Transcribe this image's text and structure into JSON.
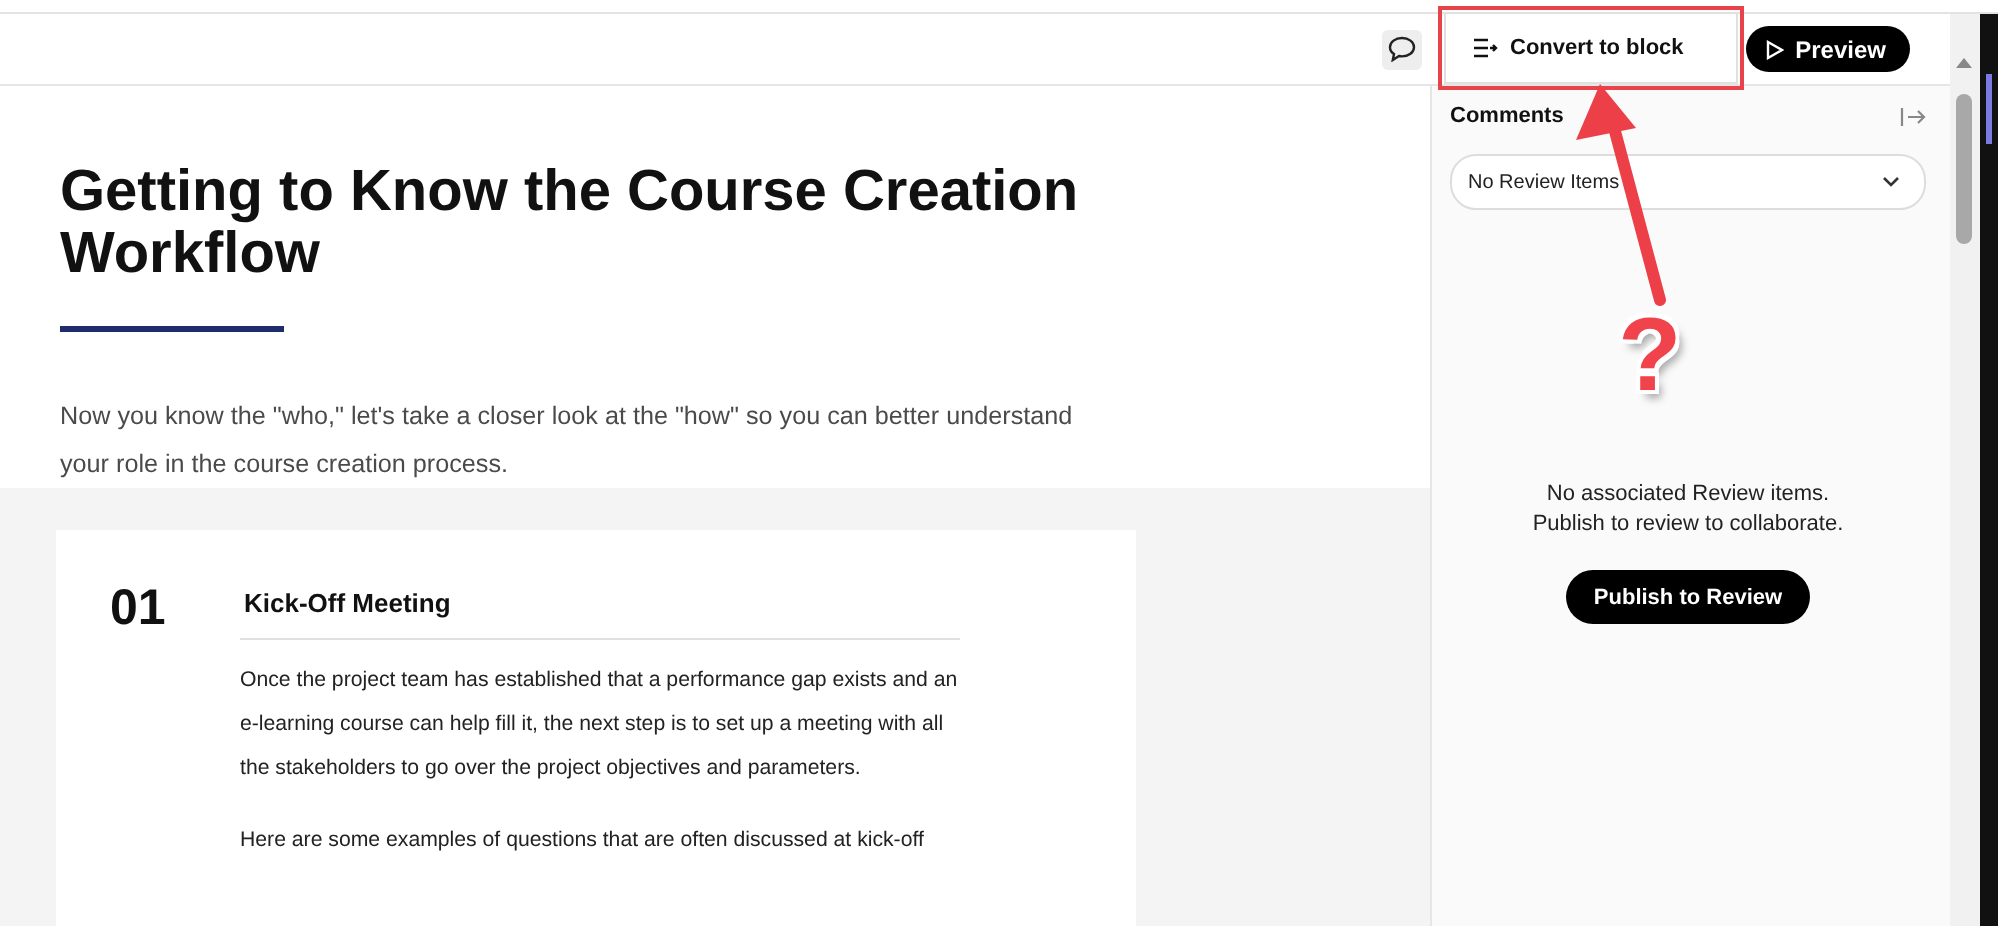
{
  "toolbar": {
    "menu_item": "Convert to block",
    "preview_button": "Preview"
  },
  "lesson": {
    "title": "Getting to Know the Course Creation Workflow",
    "intro": "Now you know the \"who,\" let's take a closer look at the \"how\" so you can better understand your role in the course creation process.",
    "steps": [
      {
        "number": "01",
        "title": "Kick-Off Meeting",
        "paragraphs": [
          "Once the project team has established that a performance gap exists and an e-learning course can help fill it, the next step is to set up a meeting with all the stakeholders to go over the project objectives and parameters.",
          "Here are some examples of questions that are often discussed at kick-off"
        ]
      }
    ]
  },
  "comments_panel": {
    "title": "Comments",
    "filter": {
      "value": "No Review Items"
    },
    "empty_message": [
      "No associated Review items.",
      "Publish to review to collaborate."
    ],
    "publish_button": "Publish to Review"
  },
  "annotation": {
    "text": "?"
  }
}
